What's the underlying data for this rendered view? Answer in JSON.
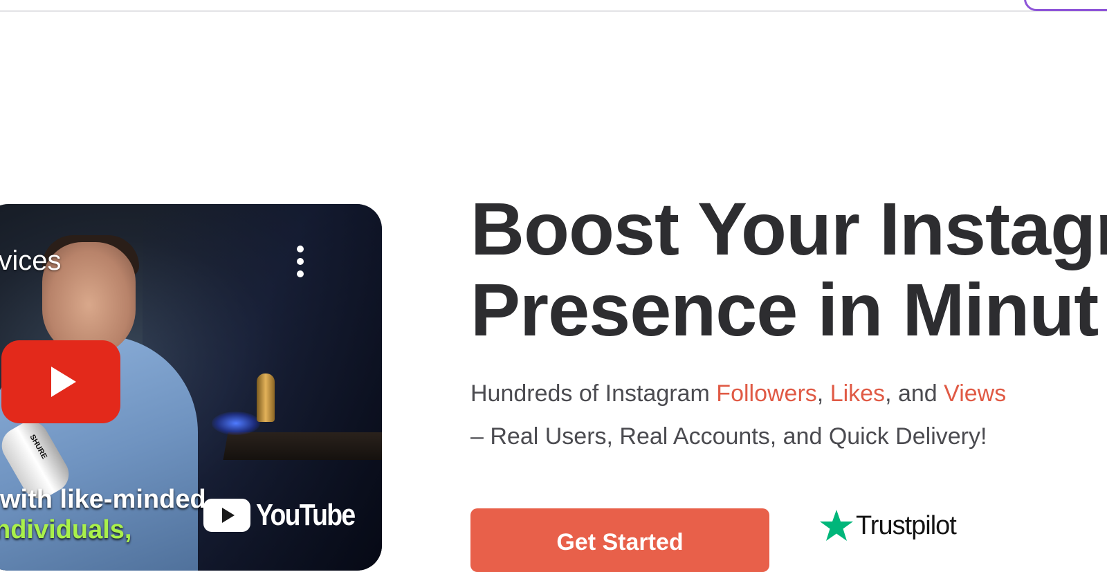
{
  "video": {
    "title": "rvices",
    "caption_line1": "with like-minded",
    "caption_line2": "ndividuals,",
    "brand_text": "YouTube",
    "mic_brand": "SHURE",
    "play_icon": "play-icon",
    "menu_icon": "more-vertical-icon"
  },
  "hero": {
    "title_line1": "Boost Your Instagr",
    "title_line2": "Presence in Minut",
    "subtitle": {
      "part1": "Hundreds of Instagram ",
      "followers": "Followers",
      "comma": ", ",
      "likes": "Likes",
      "and": ", and ",
      "views": "Views",
      "line2": "– Real Users, Real Accounts, and Quick Delivery!"
    }
  },
  "cta": {
    "label": "Get Started"
  },
  "trustpilot": {
    "label": "Trustpilot",
    "icon": "star-icon"
  },
  "colors": {
    "accent": "#e8604a",
    "highlight": "#e05a45",
    "heading": "#2d2d30",
    "trustpilot_green": "#00b67a",
    "youtube_red": "#e3291b",
    "top_pill_border": "#8e55d8"
  }
}
